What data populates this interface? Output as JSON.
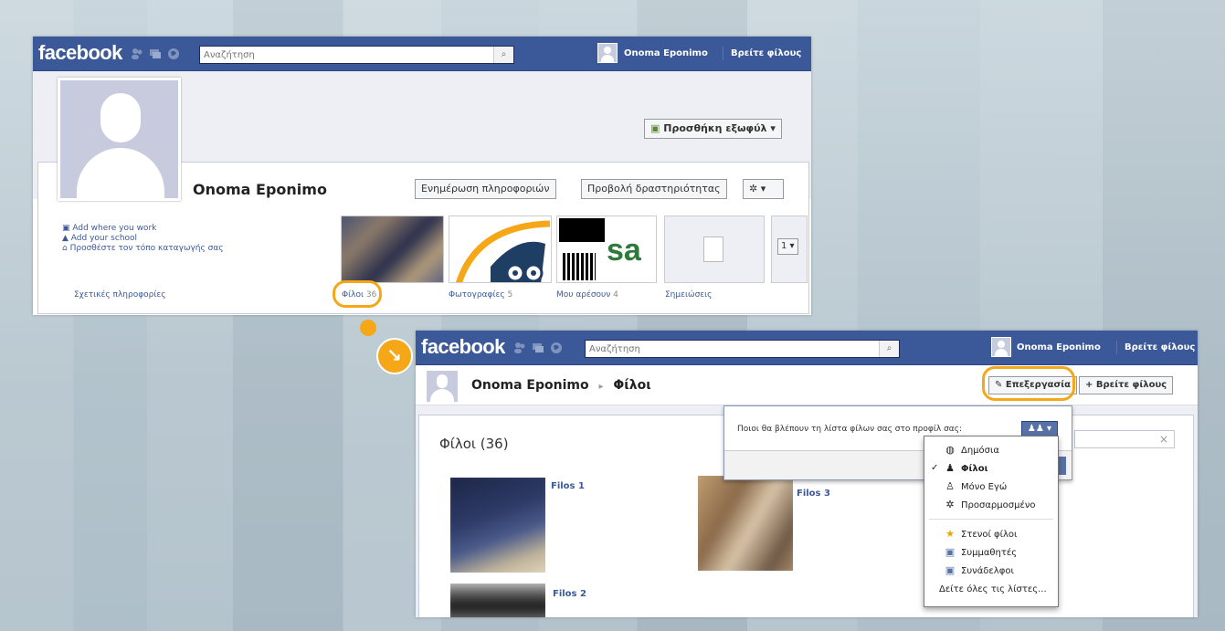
{
  "colors": {
    "brand": "#3b5998",
    "highlight": "#f5a718"
  },
  "top": {
    "logo": "facebook",
    "search_placeholder": "Αναζήτηση",
    "user_name": "Onoma Eponimo",
    "find_friends": "Βρείτε φίλους",
    "cover_button": "Προσθήκη εξωφύλ",
    "profile_name": "Onoma Eponimo",
    "update_info": "Ενημέρωση πληροφοριών",
    "view_activity": "Προβολή δραστηριότητας",
    "gear_label": "✲ ▾",
    "info": [
      "Add where you work",
      "Add your school",
      "Προσθέστε τον τόπο καταγωγής σας"
    ],
    "photo_count_select": "1",
    "tabs": {
      "about": "Σχετικές πληροφορίες",
      "friends": "Φίλοι",
      "friends_count": "36",
      "photos": "Φωτογραφίες",
      "photos_count": "5",
      "likes": "Μου αρέσουν",
      "likes_count": "4",
      "notes": "Σημειώσεις"
    }
  },
  "bottom": {
    "logo": "facebook",
    "search_placeholder": "Αναζήτηση",
    "user_name": "Onoma Eponimo",
    "find_friends": "Βρείτε φίλους",
    "page_user": "Onoma Eponimo",
    "page_section": "Φίλοι",
    "edit_button": "Επεξεργασία",
    "find_friends_button": "+ Βρείτε φίλους",
    "friends_title": "Φίλοι (36)",
    "friends": [
      "Filos 1",
      "Filos 3",
      "Filos 2"
    ],
    "privacy_question": "Ποιοι θα βλέπουν τη λίστα φίλων σας στο προφίλ σας:",
    "menu": {
      "public": "Δημόσια",
      "friends": "Φίλοι",
      "only_me": "Μόνο Εγώ",
      "custom": "Προσαρμοσμένο",
      "close_friends": "Στενοί φίλοι",
      "classmates": "Συμμαθητές",
      "colleagues": "Συνάδελφοι",
      "see_all": "Δείτε όλες τις λίστες..."
    }
  }
}
